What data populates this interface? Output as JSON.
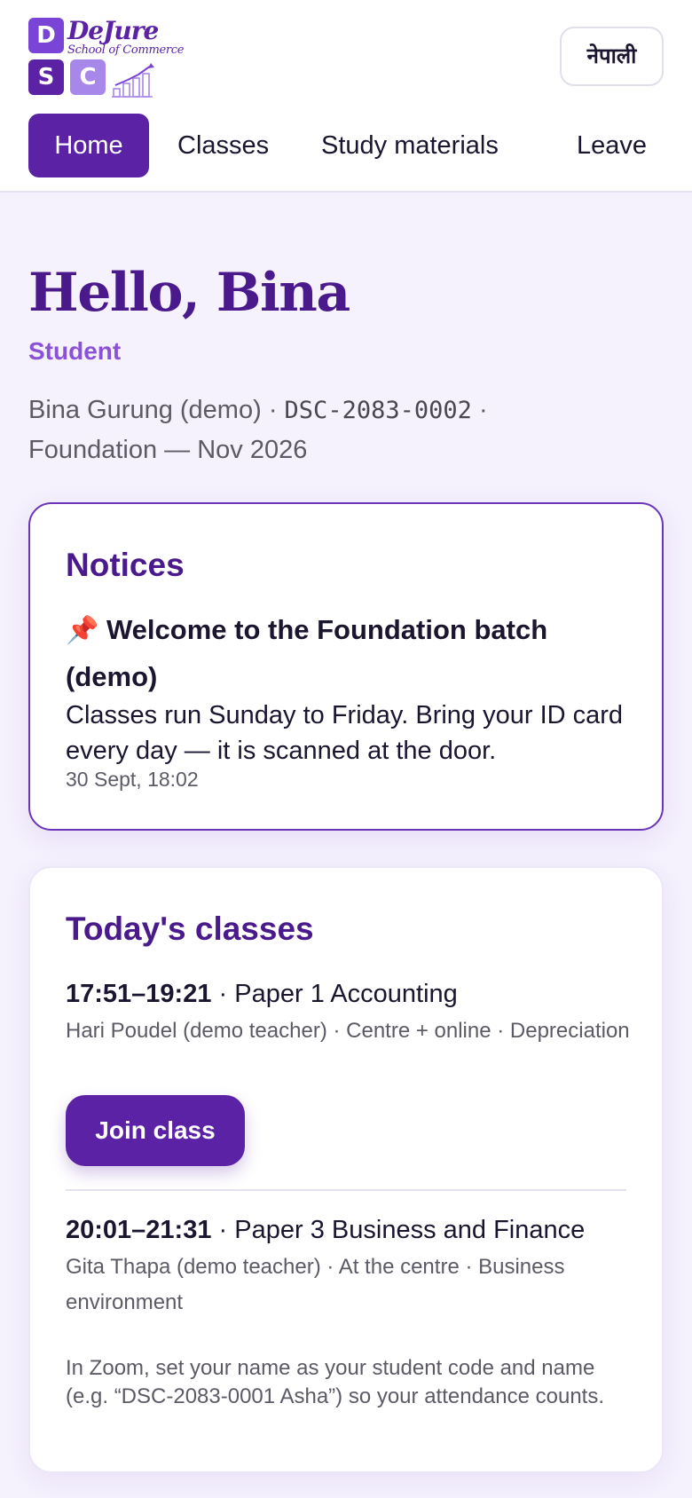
{
  "header": {
    "logo": {
      "tiles": [
        "D",
        "S",
        "C"
      ],
      "wordmark": "DeJure",
      "tagline": "School of Commerce"
    },
    "language_button": "नेपाली",
    "nav": [
      {
        "label": "Home",
        "active": true
      },
      {
        "label": "Classes",
        "active": false
      },
      {
        "label": "Study materials",
        "active": false
      },
      {
        "label": "Leave",
        "active": false
      }
    ]
  },
  "greeting": {
    "title": "Hello, Bina",
    "role": "Student",
    "name": "Bina Gurung (demo)",
    "separator": "·",
    "student_code": "DSC-2083-0002",
    "batch": "Foundation — Nov 2026"
  },
  "notices": {
    "title": "Notices",
    "items": [
      {
        "icon": "pin-icon",
        "pin_glyph": "📌",
        "title": "Welcome to the Foundation batch (demo)",
        "body": "Classes run Sunday to Friday. Bring your ID card every day — it is scanned at the door.",
        "timestamp": "30 Sept, 18:02"
      }
    ]
  },
  "todays_classes": {
    "title": "Today's classes",
    "items": [
      {
        "time": "17:51–19:21",
        "subject": "Paper 1 Accounting",
        "meta": "Hari Poudel (demo teacher) · Centre + online · Depreciation",
        "action": "Join class"
      },
      {
        "time": "20:01–21:31",
        "subject": "Paper 3 Business and Finance",
        "meta": "Gita Thapa (demo teacher) · At the centre · Business environment"
      }
    ],
    "zoom_note": "In Zoom, set your name as your student code and name (e.g. “DSC-2083-0001 Asha”) so your attendance counts."
  },
  "colors": {
    "brand": "#5b22a6",
    "brand_light": "#8a52d6",
    "page_bg": "#f5f1fd"
  }
}
